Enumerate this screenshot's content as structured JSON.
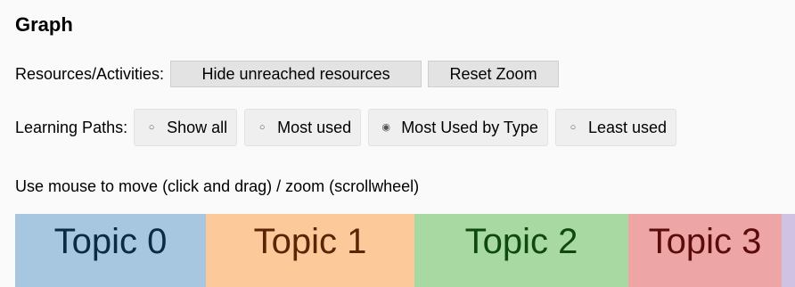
{
  "header": {
    "title": "Graph"
  },
  "resources": {
    "label": "Resources/Activities:",
    "hide_label": "Hide unreached resources",
    "reset_label": "Reset Zoom"
  },
  "paths": {
    "label": "Learning Paths:",
    "selected": "Most Used by Type",
    "options": [
      {
        "label": "Show all",
        "selected": false
      },
      {
        "label": "Most used",
        "selected": false
      },
      {
        "label": "Most Used by Type",
        "selected": true
      },
      {
        "label": "Least used",
        "selected": false
      }
    ]
  },
  "hint": "Use mouse to move (click and drag) / zoom (scrollwheel)",
  "topics": [
    {
      "label": "Topic 0",
      "bg": "#a6c7df",
      "fg": "#0d2a45"
    },
    {
      "label": "Topic 1",
      "bg": "#fcc99b",
      "fg": "#5a2405"
    },
    {
      "label": "Topic 2",
      "bg": "#a9d9a2",
      "fg": "#0e4a10"
    },
    {
      "label": "Topic 3",
      "bg": "#eda5a5",
      "fg": "#5c0b0b"
    },
    {
      "label": "",
      "bg": "#cfc2e3",
      "fg": "#2e1f48"
    }
  ]
}
